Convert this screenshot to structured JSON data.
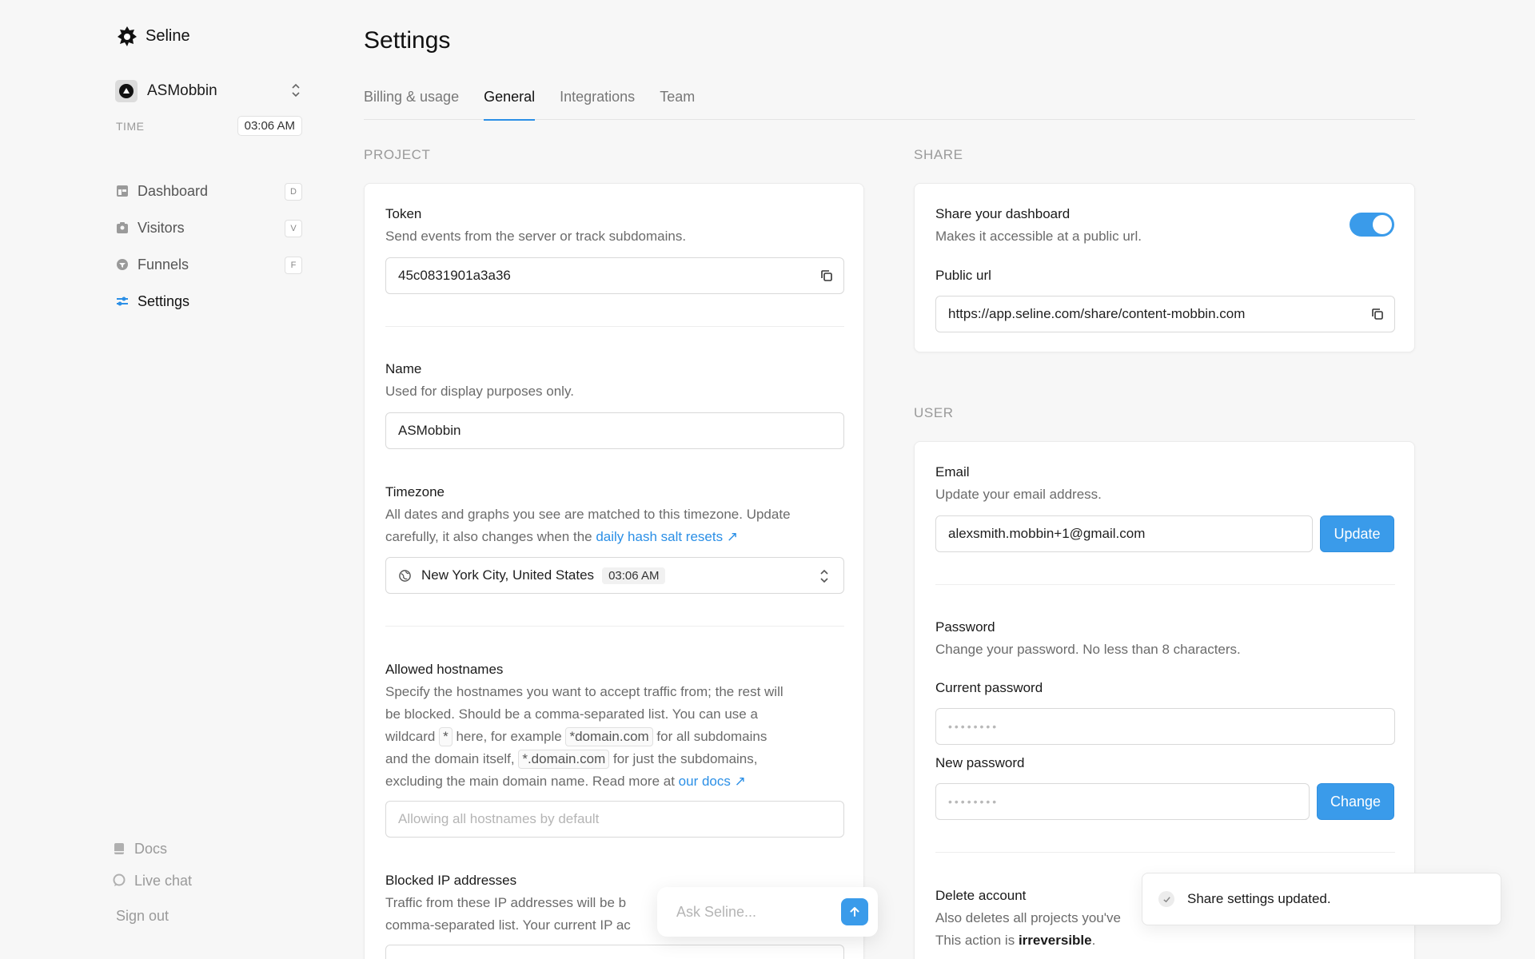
{
  "brand": {
    "name": "Seline"
  },
  "project": {
    "name": "ASMobbin"
  },
  "time": {
    "label": "TIME",
    "value": "03:06 AM"
  },
  "nav": [
    {
      "label": "Dashboard",
      "shortcut": "D"
    },
    {
      "label": "Visitors",
      "shortcut": "V"
    },
    {
      "label": "Funnels",
      "shortcut": "F"
    },
    {
      "label": "Settings"
    }
  ],
  "bottom_nav": {
    "docs": "Docs",
    "live_chat": "Live chat",
    "sign_out": "Sign out"
  },
  "page": {
    "title": "Settings"
  },
  "tabs": [
    "Billing & usage",
    "General",
    "Integrations",
    "Team"
  ],
  "project_section": {
    "label": "PROJECT",
    "token": {
      "title": "Token",
      "desc": "Send events from the server or track subdomains.",
      "value": "45c0831901a3a36"
    },
    "name": {
      "title": "Name",
      "desc": "Used for display purposes only.",
      "value": "ASMobbin"
    },
    "timezone": {
      "title": "Timezone",
      "desc_line1": "All dates and graphs you see are matched to this timezone. Update",
      "desc_line2_prefix": "carefully, it also changes when the ",
      "desc_link": "daily hash salt resets",
      "value": "New York City, United States",
      "time": "03:06 AM"
    },
    "hostnames": {
      "title": "Allowed hostnames",
      "line1": "Specify the hostnames you want to accept traffic from; the rest will",
      "line2": "be blocked. Should be a comma-separated list. You can use a",
      "line3_a": "wildcard ",
      "code1": "*",
      "line3_b": " here, for example ",
      "code2": "*domain.com",
      "line3_c": " for all subdomains",
      "line4_a": "and the domain itself, ",
      "code3": "*.domain.com",
      "line4_b": " for just the subdomains,",
      "line5": "excluding the main domain name. Read more at ",
      "line5_link": "our docs",
      "placeholder": "Allowing all hostnames by default"
    },
    "blocked_ip": {
      "title": "Blocked IP addresses",
      "line1": "Traffic from these IP addresses will be b",
      "line2": "comma-separated list. Your current IP ac"
    }
  },
  "share_section": {
    "label": "SHARE",
    "title": "Share your dashboard",
    "desc": "Makes it accessible at a public url.",
    "enabled": true,
    "public_url_label": "Public url",
    "public_url": "https://app.seline.com/share/content-mobbin.com"
  },
  "user_section": {
    "label": "USER",
    "email": {
      "title": "Email",
      "desc": "Update your email address.",
      "value": "alexsmith.mobbin+1@gmail.com",
      "button": "Update"
    },
    "password": {
      "title": "Password",
      "desc": "Change your password. No less than 8 characters.",
      "current_label": "Current password",
      "current_value": "••••••••",
      "new_label": "New password",
      "new_value": "••••••••",
      "button": "Change"
    },
    "delete": {
      "title": "Delete account",
      "desc1": "Also deletes all projects you've",
      "desc2_prefix": "This action is ",
      "desc2_bold": "irreversible",
      "desc2_suffix": "."
    }
  },
  "ask": {
    "placeholder": "Ask Seline..."
  },
  "toast": {
    "message": "Share settings updated."
  },
  "colors": {
    "accent": "#3a9bea",
    "background": "#f7f7f7"
  }
}
